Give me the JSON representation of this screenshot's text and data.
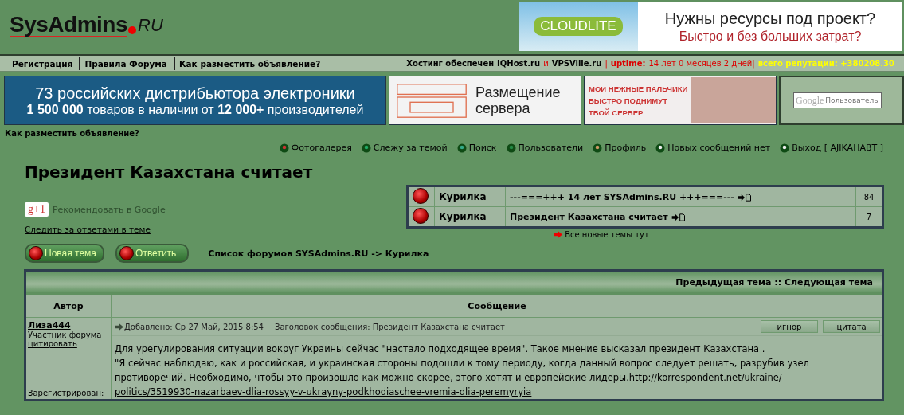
{
  "header": {
    "logo": {
      "name": "SysAdmins",
      "suffix": "RU"
    },
    "ad": {
      "brand": "CLOUDLITE",
      "headline": "Нужны ресурсы под проект?",
      "subline": "Быстро и без больших затрат?"
    }
  },
  "topnav": {
    "links": [
      "Регистрация",
      "Правила Форума",
      "Как разместить объявление?"
    ],
    "hosting": {
      "prefix": "Хостинг обеспечен",
      "host_1": "IQHost.ru",
      "joiner": "и",
      "host_2": "VPSVille.ru",
      "divider": "|",
      "uptime_label": "uptime:",
      "uptime_value": "14 лет 0 месяцев 2 дней|",
      "reputation": "всего репутации: +380208.30"
    }
  },
  "banners": [
    {
      "kind": "text",
      "line_1": "73 российских дистрибьютора электроники",
      "line_2": "**1 500 000** товаров в наличии от **12 000+** производителей"
    },
    {
      "kind": "server",
      "line_1": "Размещение",
      "line_2": "сервера"
    },
    {
      "kind": "photo",
      "line_1": "МОИ НЕЖНЫЕ ПАЛЬЧИКИ",
      "line_2": "БЫСТРО ПОДНИМУТ",
      "line_3": "ТВОЙ СЕРВЕР"
    }
  ],
  "search": {
    "logo": "Google",
    "placeholder": "Пользователь"
  },
  "ad_link": "Как разместить объявление?",
  "menu": [
    {
      "kind": "gallery",
      "label": "Фотогалерея"
    },
    {
      "kind": "watch",
      "label": "Слежу за темой"
    },
    {
      "kind": "search",
      "label": "Поиск"
    },
    {
      "kind": "users",
      "label": "Пользователи"
    },
    {
      "kind": "profile",
      "label": "Профиль"
    },
    {
      "kind": "mail",
      "label": "Новых сообщений нет"
    },
    {
      "kind": "logout",
      "label": "Выход [ AJIKAHABT ]"
    }
  ],
  "title": "Президент Казахстана считает",
  "gplus": {
    "badge": "g+1",
    "label": "Рекомендовать в Google"
  },
  "follow_link": "Следить за ответами в теме",
  "actions": [
    "Новая тема",
    "Ответить"
  ],
  "breadcrumb": "Список форумов SYSAdmins.RU -> Курилка",
  "recent_topics": {
    "rows": [
      {
        "forum": "Курилка",
        "topic": "---===+++ 14 лет SYSAdmins.RU +++===---",
        "replies": "84"
      },
      {
        "forum": "Курилка",
        "topic": "Президент Казахстана считает",
        "replies": "7"
      }
    ],
    "all_new": "Все новые темы тут"
  },
  "post_table": {
    "nav": "Предыдущая тема :: Следующая тема",
    "columns": [
      "Автор",
      "Сообщение"
    ],
    "posts": [
      {
        "author": "Лиза444",
        "rank": "Участник форума",
        "quote_link": "цитировать",
        "registered": "Зарегистрирован:",
        "added": "Добавлено: Ср 27 Май, 2015 8:54",
        "subject": "Заголовок сообщения: Президент Казахстана считает",
        "buttons": [
          "игнор",
          "цитата"
        ],
        "paragraphs": [
          "Для урегулирования ситуации вокруг Украины сейчас \"настало подходящее время\". Такое мнение высказал президент Казахстана .",
          "\"Я сейчас наблюдаю, как и российская, и украинская стороны подошли к тому периоду, когда данный вопрос следует решать, разрубив узел противоречий. Необходимо, чтобы это произошло как можно скорее, этого хотят и европейские лидеры."
        ],
        "link_lines": [
          "http://korrespondent.net/ukraine/",
          "politics/3519930-nazarbaev-dlia-rossyy-v-ukrayny-podkhodiaschee-vremia-dlia-peremyryia"
        ]
      }
    ]
  }
}
